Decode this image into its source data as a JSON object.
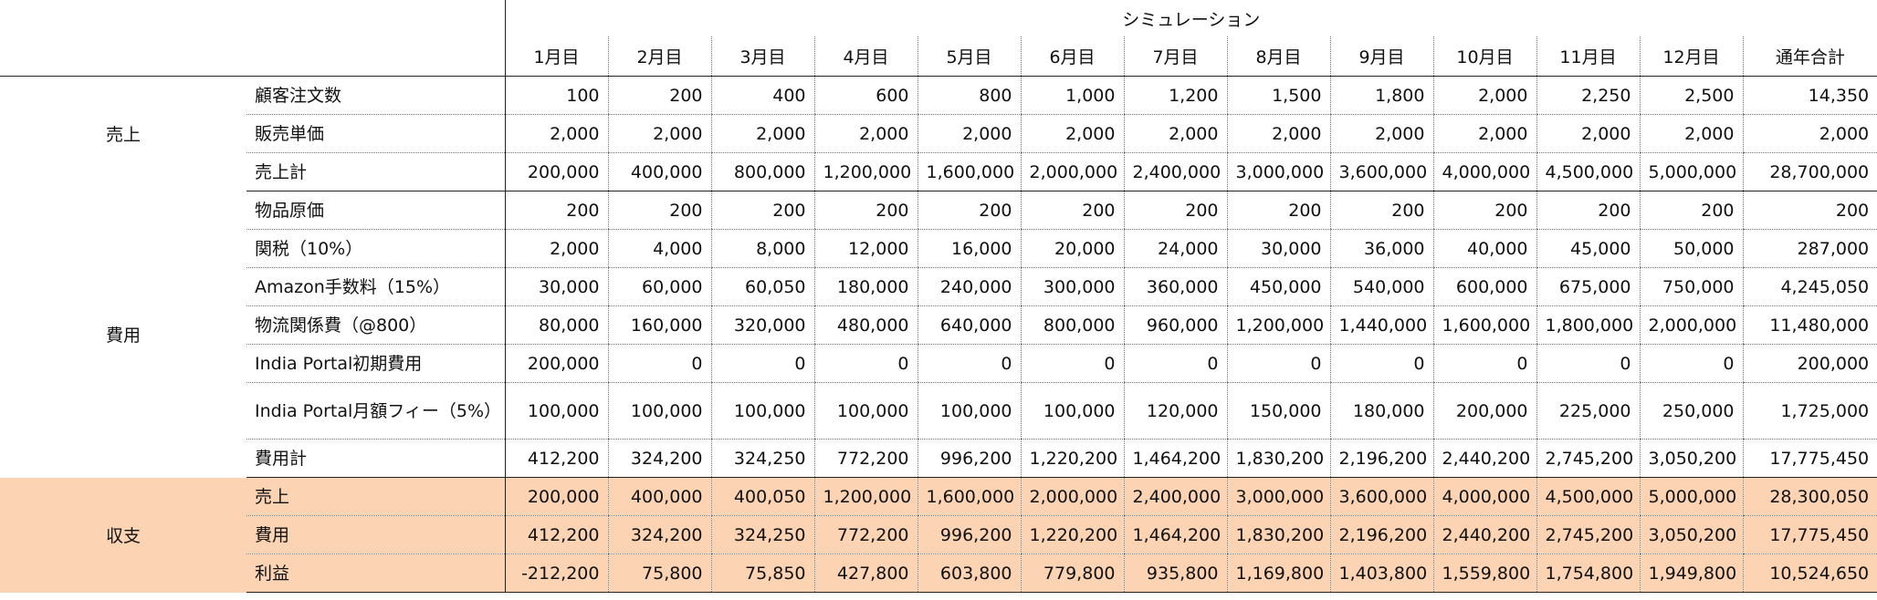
{
  "header": {
    "simulation_label": "シミュレーション",
    "months": [
      "1月目",
      "2月目",
      "3月目",
      "4月目",
      "5月目",
      "6月目",
      "7月目",
      "8月目",
      "9月目",
      "10月目",
      "11月目",
      "12月目",
      "通年合計"
    ]
  },
  "groups": [
    {
      "key": "sales",
      "label": "売上",
      "highlight": false,
      "rows": [
        {
          "label": "顧客注文数",
          "values": [
            "100",
            "200",
            "400",
            "600",
            "800",
            "1,000",
            "1,200",
            "1,500",
            "1,800",
            "2,000",
            "2,250",
            "2,500",
            "14,350"
          ]
        },
        {
          "label": "販売単価",
          "values": [
            "2,000",
            "2,000",
            "2,000",
            "2,000",
            "2,000",
            "2,000",
            "2,000",
            "2,000",
            "2,000",
            "2,000",
            "2,000",
            "2,000",
            "2,000"
          ]
        },
        {
          "label": "売上計",
          "values": [
            "200,000",
            "400,000",
            "800,000",
            "1,200,000",
            "1,600,000",
            "2,000,000",
            "2,400,000",
            "3,000,000",
            "3,600,000",
            "4,000,000",
            "4,500,000",
            "5,000,000",
            "28,700,000"
          ]
        }
      ]
    },
    {
      "key": "costs",
      "label": "費用",
      "highlight": false,
      "rows": [
        {
          "label": "物品原価",
          "values": [
            "200",
            "200",
            "200",
            "200",
            "200",
            "200",
            "200",
            "200",
            "200",
            "200",
            "200",
            "200",
            "200"
          ]
        },
        {
          "label": "関税（10%）",
          "values": [
            "2,000",
            "4,000",
            "8,000",
            "12,000",
            "16,000",
            "20,000",
            "24,000",
            "30,000",
            "36,000",
            "40,000",
            "45,000",
            "50,000",
            "287,000"
          ]
        },
        {
          "label": "Amazon手数料（15%）",
          "values": [
            "30,000",
            "60,000",
            "60,050",
            "180,000",
            "240,000",
            "300,000",
            "360,000",
            "450,000",
            "540,000",
            "600,000",
            "675,000",
            "750,000",
            "4,245,050"
          ]
        },
        {
          "label": "物流関係費（@800）",
          "values": [
            "80,000",
            "160,000",
            "320,000",
            "480,000",
            "640,000",
            "800,000",
            "960,000",
            "1,200,000",
            "1,440,000",
            "1,600,000",
            "1,800,000",
            "2,000,000",
            "11,480,000"
          ]
        },
        {
          "label": "India Portal初期費用",
          "values": [
            "200,000",
            "0",
            "0",
            "0",
            "0",
            "0",
            "0",
            "0",
            "0",
            "0",
            "0",
            "0",
            "200,000"
          ]
        },
        {
          "label": "India Portal月額フィー（5%）",
          "tall": true,
          "values": [
            "100,000",
            "100,000",
            "100,000",
            "100,000",
            "100,000",
            "100,000",
            "120,000",
            "150,000",
            "180,000",
            "200,000",
            "225,000",
            "250,000",
            "1,725,000"
          ]
        },
        {
          "label": "費用計",
          "values": [
            "412,200",
            "324,200",
            "324,250",
            "772,200",
            "996,200",
            "1,220,200",
            "1,464,200",
            "1,830,200",
            "2,196,200",
            "2,440,200",
            "2,745,200",
            "3,050,200",
            "17,775,450"
          ]
        }
      ]
    },
    {
      "key": "balance",
      "label": "収支",
      "highlight": true,
      "highlight_color": "#fcd3b3",
      "rows": [
        {
          "label": "売上",
          "values": [
            "200,000",
            "400,000",
            "400,050",
            "1,200,000",
            "1,600,000",
            "2,000,000",
            "2,400,000",
            "3,000,000",
            "3,600,000",
            "4,000,000",
            "4,500,000",
            "5,000,000",
            "28,300,050"
          ]
        },
        {
          "label": "費用",
          "values": [
            "412,200",
            "324,200",
            "324,250",
            "772,200",
            "996,200",
            "1,220,200",
            "1,464,200",
            "1,830,200",
            "2,196,200",
            "2,440,200",
            "2,745,200",
            "3,050,200",
            "17,775,450"
          ]
        },
        {
          "label": "利益",
          "values": [
            "-212,200",
            "75,800",
            "75,850",
            "427,800",
            "603,800",
            "779,800",
            "935,800",
            "1,169,800",
            "1,403,800",
            "1,559,800",
            "1,754,800",
            "1,949,800",
            "10,524,650"
          ]
        }
      ]
    }
  ]
}
